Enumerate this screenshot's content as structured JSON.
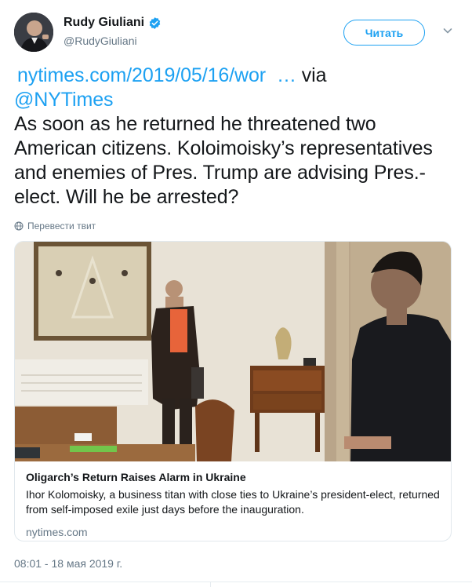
{
  "author": {
    "display_name": "Rudy Giuliani",
    "handle": "@RudyGiuliani",
    "verified": true
  },
  "header": {
    "follow_label": "Читать",
    "menu_icon": "chevron-down-icon"
  },
  "tweet": {
    "link_text": "nytimes.com/2019/05/16/wor",
    "ellipsis": "…",
    "via": " via",
    "mention": "@NYTimes",
    "body": "As soon as he returned he threatened two American citizens. Koloimoisky’s representatives and enemies of Pres. Trump are advising Pres.-elect. Will he be arrested?"
  },
  "translate": {
    "label": "Перевести твит",
    "icon": "globe-icon"
  },
  "card": {
    "title": "Oligarch’s Return Raises Alarm in Ukraine",
    "description": "Ihor Kolomoisky, a business titan with close ties to Ukraine’s president-elect, returned from self-imposed exile just days before the inauguration.",
    "domain": "nytimes.com"
  },
  "timestamp": "08:01 - 18 мая 2019 г.",
  "colors": {
    "accent": "#1da1f2",
    "text": "#14171a",
    "secondary": "#657786",
    "border": "#e1e8ed"
  }
}
